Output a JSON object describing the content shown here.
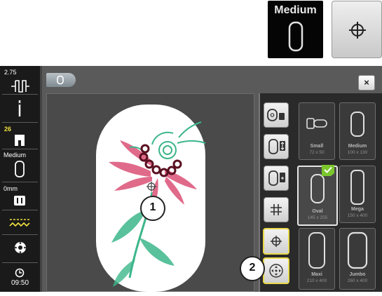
{
  "callouts": {
    "medium_label": "Medium",
    "center_icon": "crosshair-icon"
  },
  "statusbar": {
    "stitch_width": "2.75",
    "needle_icon": "needle-icon",
    "presser_foot_number": "26",
    "hoop_label": "Medium",
    "stitch_length_label": "0mm",
    "thread_icon": "thread-tension-icon",
    "bobbin_icon": "bobbin-icon",
    "clock_icon": "clock-icon",
    "time": "09:50"
  },
  "panel": {
    "title_tab_icon": "hoop-tab-icon",
    "close_label": "×"
  },
  "hoops": [
    {
      "name": "Small",
      "size": "72 x 50",
      "selected": false
    },
    {
      "name": "Medium",
      "size": "100 x 130",
      "selected": false
    },
    {
      "name": "Oval",
      "size": "145 x 255",
      "selected": true
    },
    {
      "name": "Mega",
      "size": "150 x 400",
      "selected": false
    },
    {
      "name": "Maxi",
      "size": "210 x 400",
      "selected": false
    },
    {
      "name": "Jumbo",
      "size": "260 x 400",
      "selected": false
    }
  ],
  "markers": {
    "marker1": "1",
    "marker2": "2"
  },
  "colors": {
    "accent_yellow": "#e8d94a",
    "selected_check": "#7cc62d",
    "panel_bg": "#5a5a5a",
    "design_pink": "#e06a8a",
    "design_green": "#3cb68a"
  }
}
